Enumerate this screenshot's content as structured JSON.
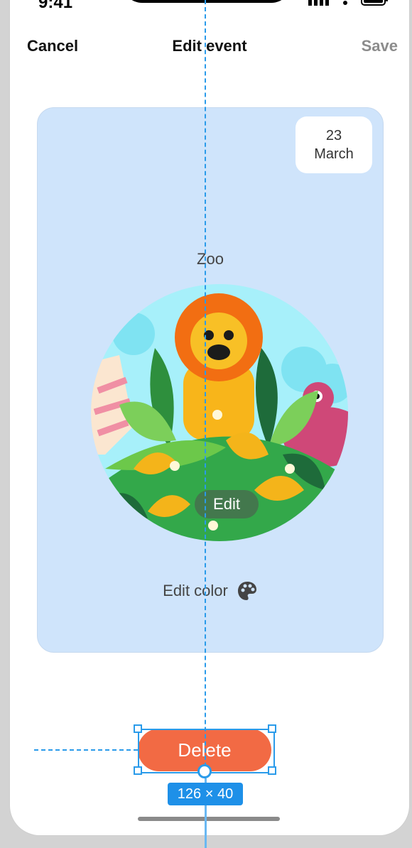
{
  "status": {
    "time": "9:41"
  },
  "nav": {
    "cancel": "Cancel",
    "title": "Edit event",
    "save": "Save"
  },
  "card": {
    "background": "#cfe4fb",
    "date_day": "23",
    "date_month": "March",
    "event_name": "Zoo",
    "edit_label": "Edit",
    "edit_color_label": "Edit color",
    "palette_icon": "palette-icon"
  },
  "delete": {
    "label": "Delete",
    "color": "#f26a44"
  },
  "overlay": {
    "dimensions": "126 × 40",
    "accent": "#2a9bea"
  }
}
